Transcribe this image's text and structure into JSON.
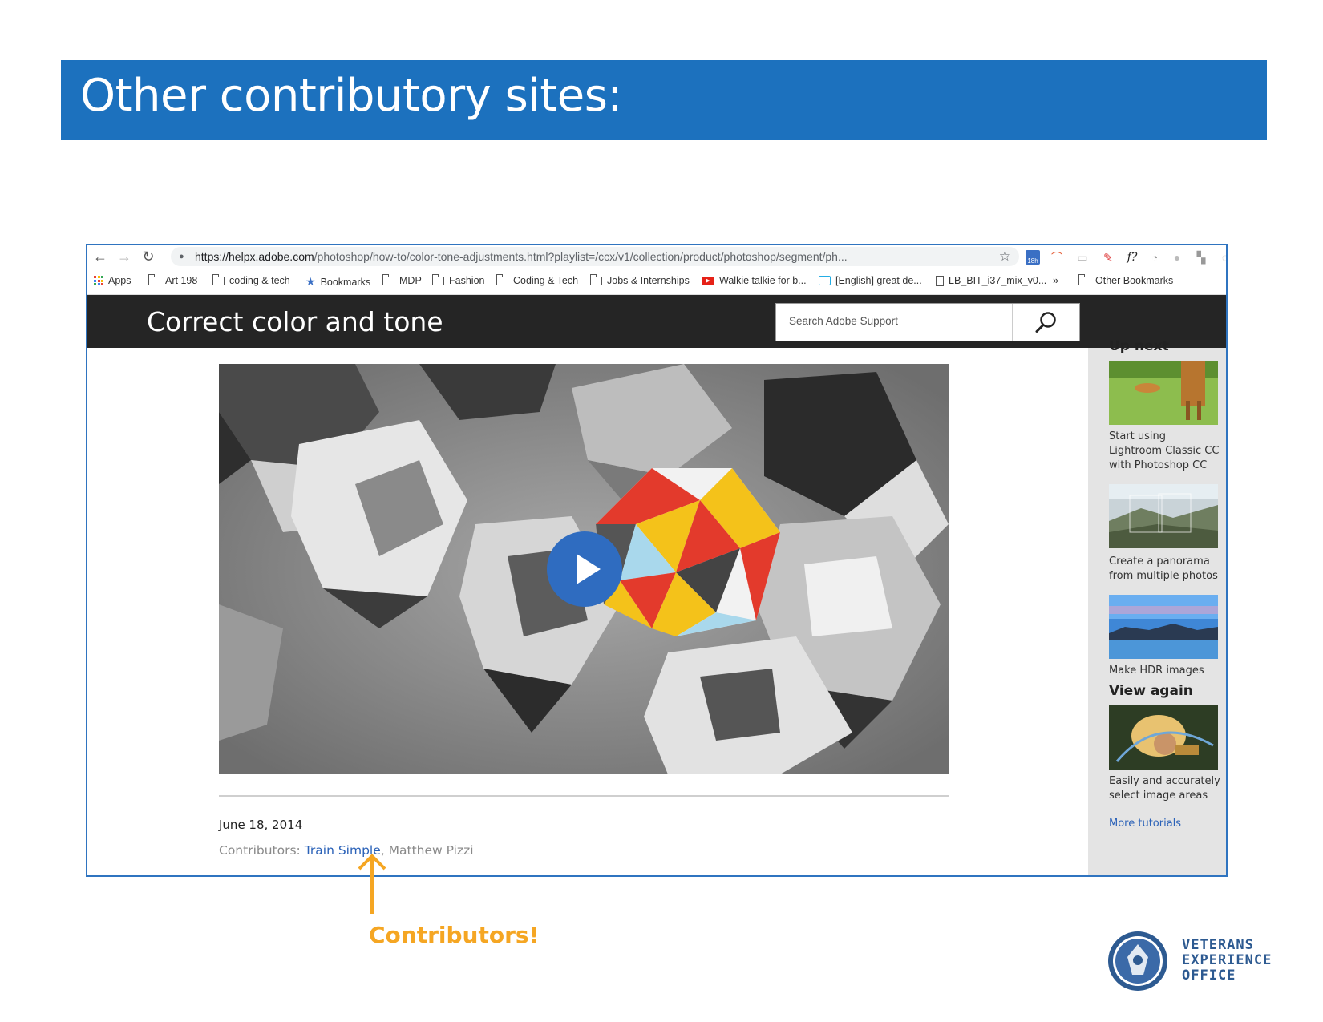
{
  "slide": {
    "title": "Other contributory sites:",
    "annotation": "Contributors!",
    "org_name_line1": "VETERANS",
    "org_name_line2": "EXPERIENCE",
    "org_name_line3": "OFFICE",
    "accent": "#1c71be",
    "annotation_color": "#f5a623"
  },
  "browser": {
    "url_host": "https://helpx.adobe.com",
    "url_path": "/photoshop/how-to/color-tone-adjustments.html?playlist=/ccx/v1/collection/product/photoshop/segment/ph...",
    "extension_badge": "18h",
    "bookmarks": [
      {
        "label": "Apps",
        "icon": "apps-grid-icon"
      },
      {
        "label": "Art 198",
        "icon": "folder-icon"
      },
      {
        "label": "coding & tech",
        "icon": "folder-icon"
      },
      {
        "label": "Bookmarks",
        "icon": "star-icon"
      },
      {
        "label": "MDP",
        "icon": "folder-icon"
      },
      {
        "label": "Fashion",
        "icon": "folder-icon"
      },
      {
        "label": "Coding & Tech",
        "icon": "folder-icon"
      },
      {
        "label": "Jobs & Internships",
        "icon": "folder-icon"
      },
      {
        "label": "Walkie talkie for b...",
        "icon": "youtube-icon"
      },
      {
        "label": "[English] great de...",
        "icon": "bilibili-icon"
      },
      {
        "label": "LB_BIT_i37_mix_v0...",
        "icon": "file-icon"
      }
    ],
    "overflow": "»",
    "other_bookmarks": "Other Bookmarks"
  },
  "page": {
    "title": "Correct color and tone",
    "search_placeholder": "Search Adobe Support",
    "date": "June 18, 2014",
    "contributors_label": "Contributors: ",
    "contributor_link": "Train Simple",
    "contributor_separator": ", ",
    "contributor_other": "Matthew Pizzi"
  },
  "sidebar": {
    "up_next": "Up next",
    "items": [
      {
        "caption": "Start using Lightroom Classic CC with Photoshop CC"
      },
      {
        "caption": "Create a panorama from multiple photos"
      },
      {
        "caption": "Make HDR images"
      }
    ],
    "view_again": "View again",
    "view_again_item": {
      "caption": "Easily and accurately select image areas"
    },
    "more_tutorials": "More tutorials"
  }
}
